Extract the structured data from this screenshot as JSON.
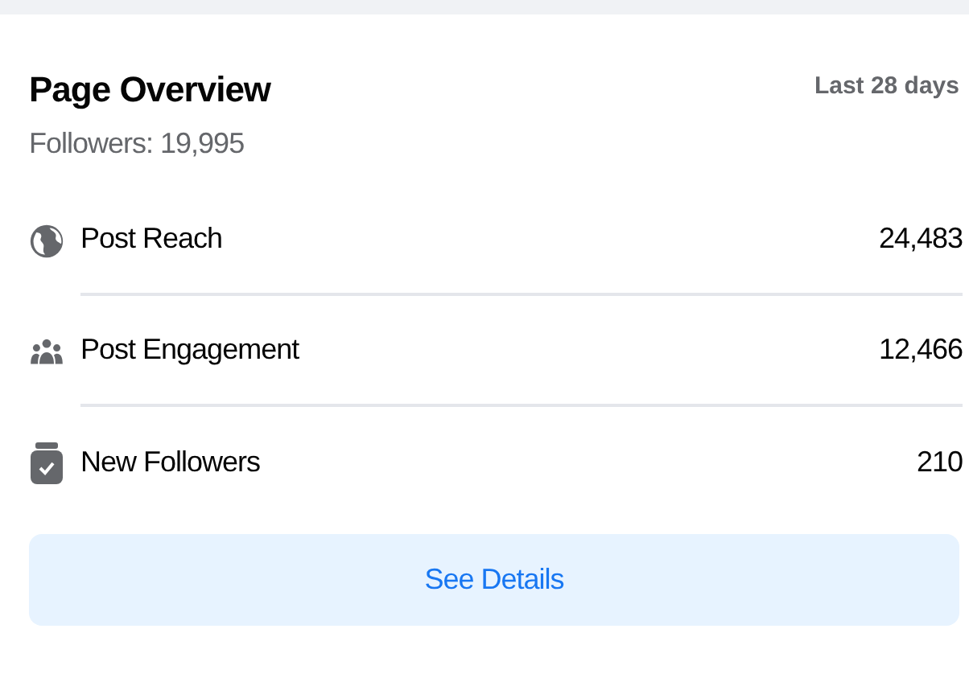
{
  "title": "Page Overview",
  "period": "Last 28 days",
  "followers": "Followers: 19,995",
  "metrics": [
    {
      "kind": "globe",
      "label": "Post Reach",
      "value": "24,483"
    },
    {
      "kind": "people",
      "label": "Post Engagement",
      "value": "12,466"
    },
    {
      "kind": "jar",
      "label": "New Followers",
      "value": "210"
    }
  ],
  "button": "See Details"
}
